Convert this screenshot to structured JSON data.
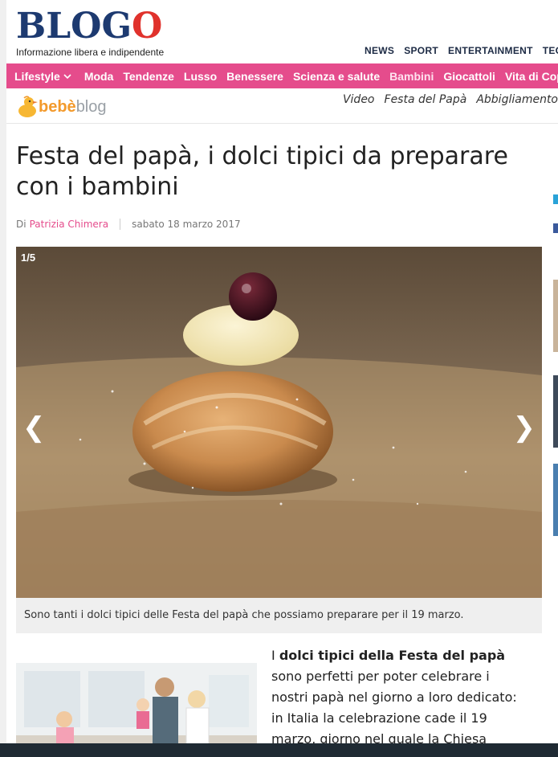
{
  "brand": {
    "logo_main": "BLOG",
    "logo_o": "O",
    "tagline": "Informazione libera e indipendente"
  },
  "topnav": [
    "NEWS",
    "SPORT",
    "ENTERTAINMENT",
    "TECH"
  ],
  "pinknav": {
    "lifestyle": "Lifestyle",
    "items": [
      "Moda",
      "Tendenze",
      "Lusso",
      "Benessere",
      "Scienza e salute",
      "Bambini",
      "Giocattoli",
      "Vita di Coppia"
    ],
    "active": "Bambini"
  },
  "subhead": {
    "logo_part1": "bebè",
    "logo_part2": "blog",
    "links": [
      "Video",
      "Festa del Papà",
      "Abbigliamento"
    ]
  },
  "article": {
    "title": "Festa del papà, i dolci tipici da preparare con i bambini",
    "by": "Di",
    "author": "Patrizia Chimera",
    "date": "sabato 18 marzo 2017",
    "gallery_counter": "1/5",
    "caption": "Sono tanti i dolci tipici delle Festa del papà che possiamo preparare per il 19 marzo.",
    "body_intro": "I",
    "body_bold": "dolci tipici della Festa del papà",
    "body_rest": "sono perfetti per poter celebrare i nostri papà nel giorno a loro dedicato: in Italia la celebrazione cade il 19 marzo, giorno nel quale la Chiesa Cattolica ricorda San"
  },
  "icons": {
    "prev": "chevron-left-icon",
    "next": "chevron-right-icon",
    "dropdown": "chevron-down-icon",
    "duck": "duck-icon"
  },
  "colors": {
    "pink": "#e54c8c",
    "navy": "#1d3a70",
    "red": "#e0322c",
    "orange": "#f39a2c"
  }
}
